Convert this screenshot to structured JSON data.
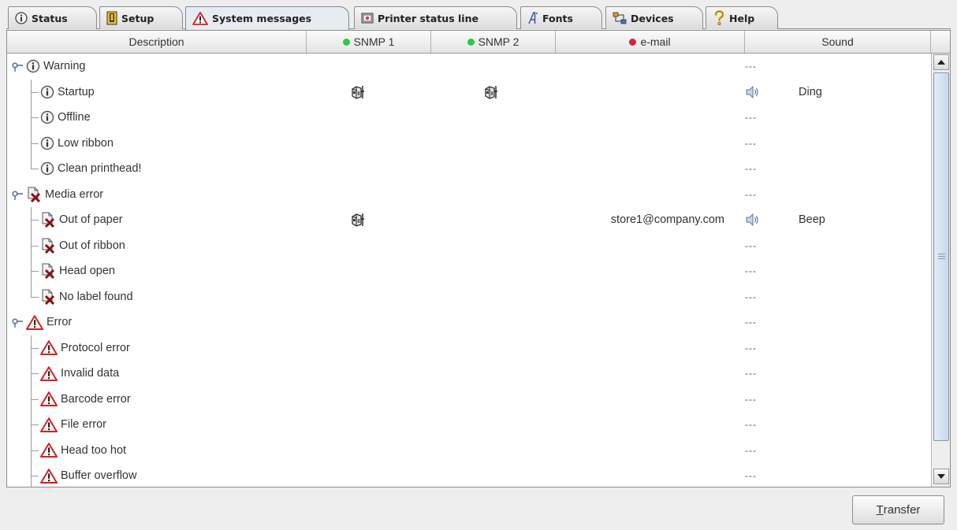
{
  "tabs": [
    {
      "label": "Status",
      "icon": "info-icon"
    },
    {
      "label": "Setup",
      "icon": "printer-setup-icon"
    },
    {
      "label": "System messages",
      "icon": "warning-icon",
      "active": true
    },
    {
      "label": "Printer status line",
      "icon": "display-icon"
    },
    {
      "label": "Fonts",
      "icon": "font-icon"
    },
    {
      "label": "Devices",
      "icon": "devices-icon"
    },
    {
      "label": "Help",
      "icon": "help-icon"
    }
  ],
  "columns": {
    "description": "Description",
    "snmp1": "SNMP 1",
    "snmp2": "SNMP 2",
    "email": "e-mail",
    "sound": "Sound"
  },
  "colors": {
    "snmp_dot": "#2ec84a",
    "email_dot": "#e0203a",
    "accent": "#7f97b3"
  },
  "rows": [
    {
      "label": "Warning",
      "group": true,
      "icon": "info-icon",
      "dash": "---"
    },
    {
      "label": "Startup",
      "icon": "info-icon",
      "snmp1": true,
      "snmp2": true,
      "sound": "Ding"
    },
    {
      "label": "Offline",
      "icon": "info-icon",
      "dash": "---"
    },
    {
      "label": "Low ribbon",
      "icon": "info-icon",
      "dash": "---"
    },
    {
      "label": "Clean printhead!",
      "icon": "info-icon",
      "dash": "---",
      "last": true
    },
    {
      "label": "Media error",
      "group": true,
      "icon": "media-error-icon",
      "dash": "---"
    },
    {
      "label": "Out of paper",
      "icon": "media-error-icon",
      "snmp1": true,
      "email": "store1@company.com",
      "sound": "Beep"
    },
    {
      "label": "Out of ribbon",
      "icon": "media-error-icon",
      "dash": "---"
    },
    {
      "label": "Head open",
      "icon": "media-error-icon",
      "dash": "---"
    },
    {
      "label": "No label found",
      "icon": "media-error-icon",
      "dash": "---",
      "last": true
    },
    {
      "label": "Error",
      "group": true,
      "icon": "warning-icon",
      "dash": "---"
    },
    {
      "label": "Protocol error",
      "icon": "warning-icon",
      "dash": "---"
    },
    {
      "label": "Invalid data",
      "icon": "warning-icon",
      "dash": "---"
    },
    {
      "label": "Barcode error",
      "icon": "warning-icon",
      "dash": "---"
    },
    {
      "label": "File error",
      "icon": "warning-icon",
      "dash": "---"
    },
    {
      "label": "Head too hot",
      "icon": "warning-icon",
      "dash": "---"
    },
    {
      "label": "Buffer overflow",
      "icon": "warning-icon",
      "dash": "---"
    }
  ],
  "transfer_button": {
    "label_prefix": "T",
    "label_rest": "ransfer"
  }
}
